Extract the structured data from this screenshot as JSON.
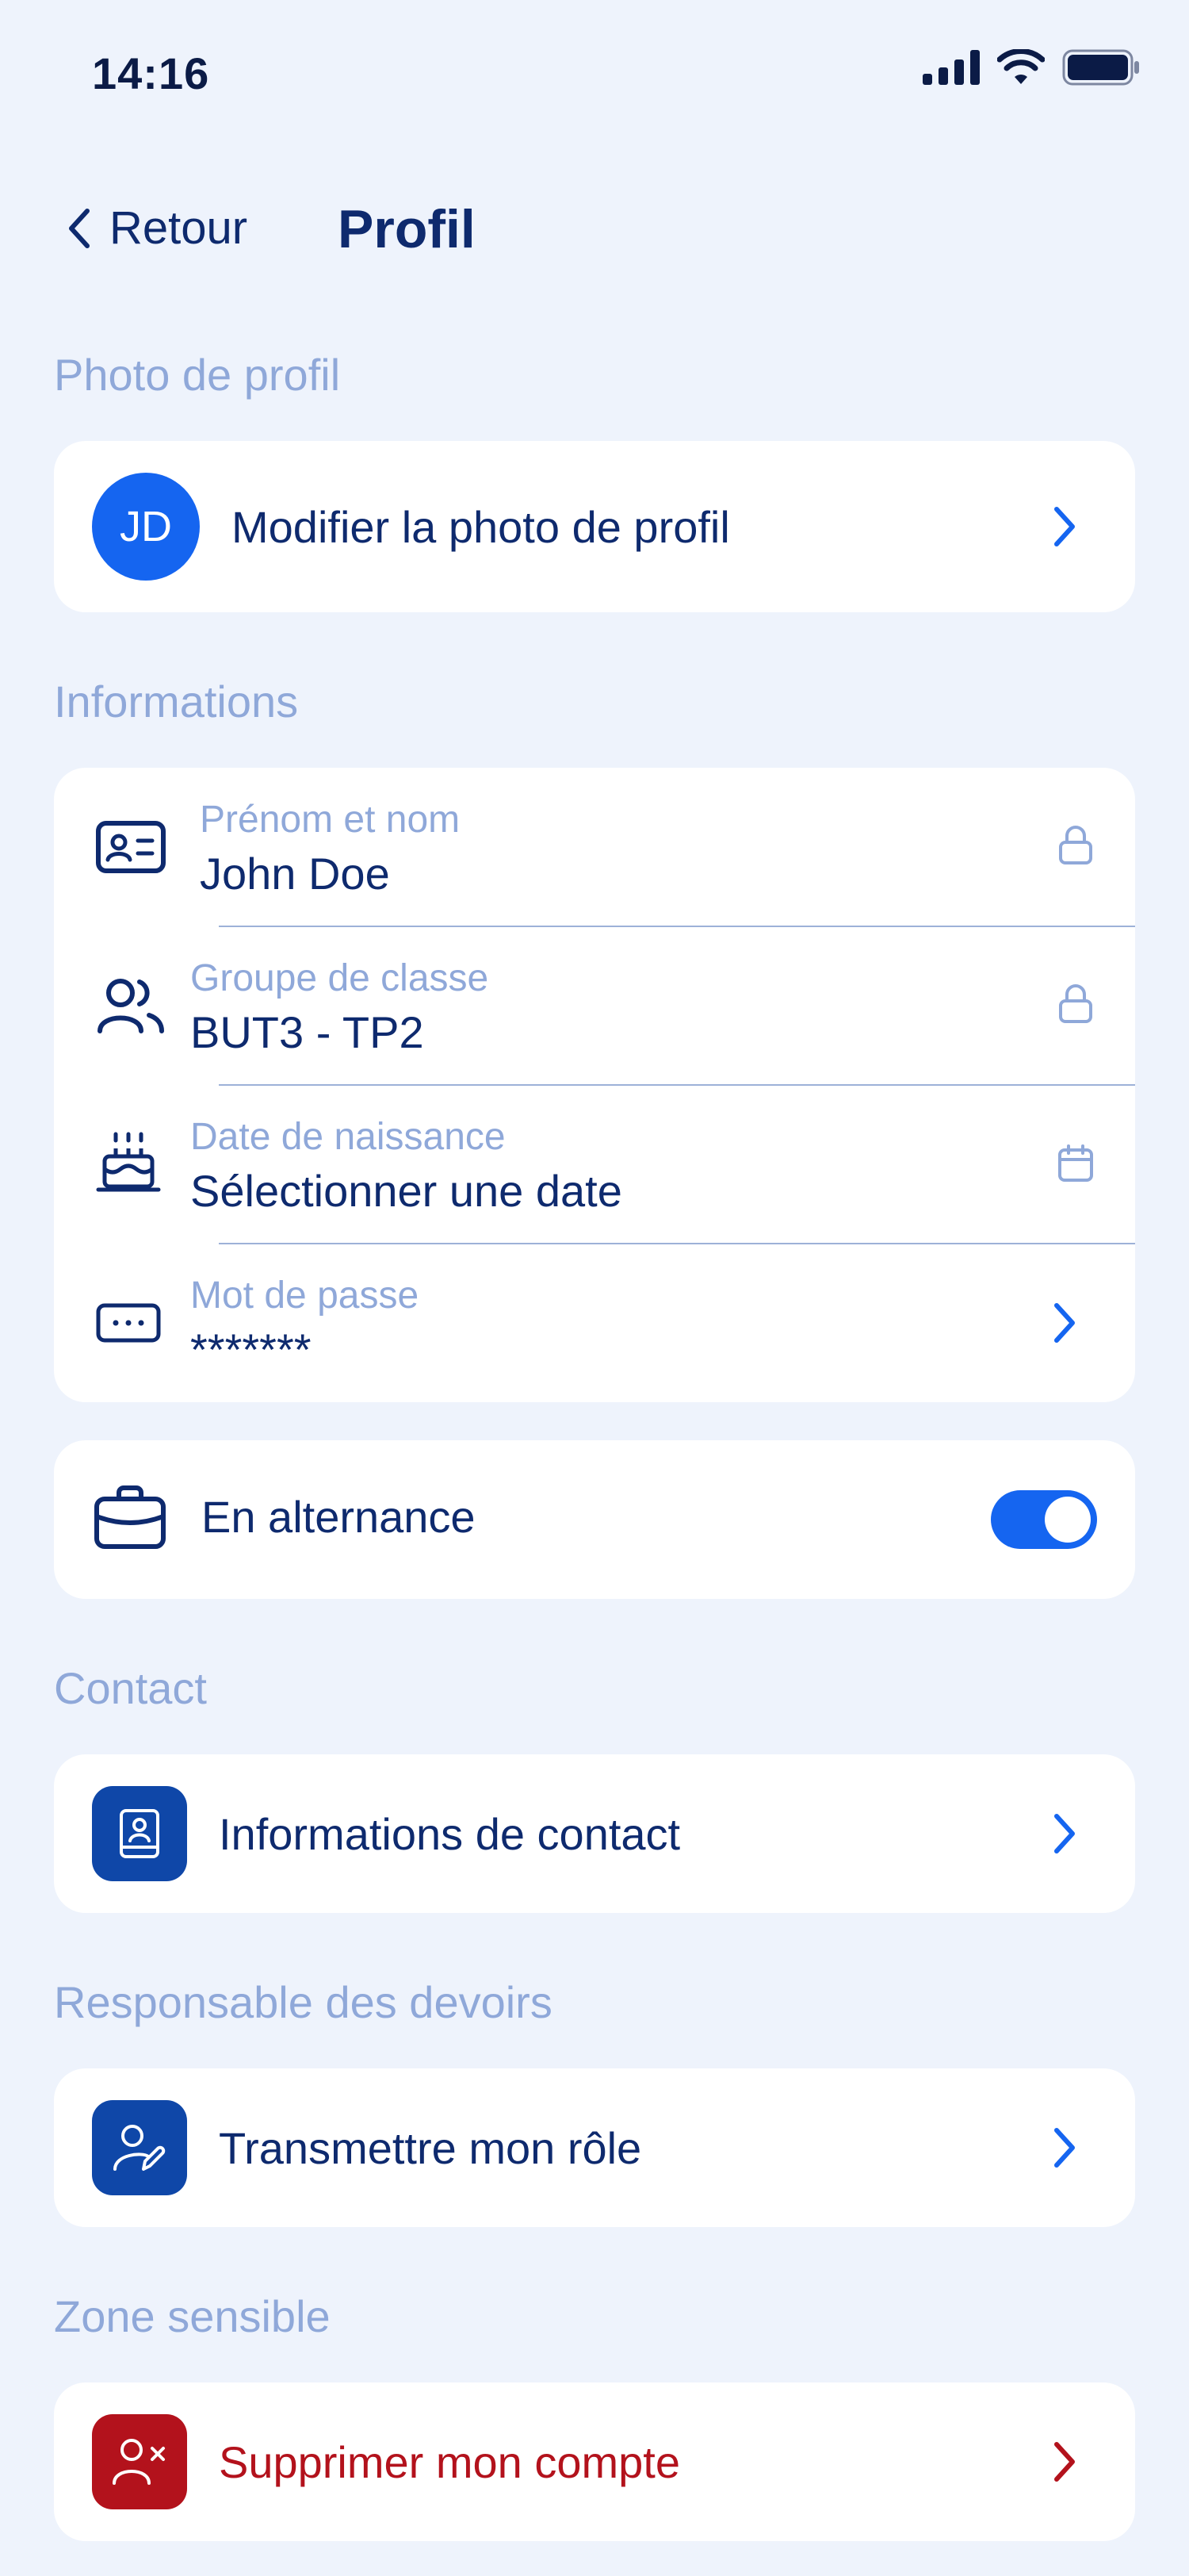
{
  "status_bar": {
    "time": "14:16"
  },
  "nav": {
    "back_label": "Retour",
    "title": "Profil"
  },
  "sections": {
    "photo": {
      "label": "Photo de profil",
      "initials": "JD",
      "action": "Modifier la photo de profil"
    },
    "informations": {
      "label": "Informations",
      "fields": [
        {
          "label": "Prénom et nom",
          "value": "John Doe",
          "icon": "id-card-icon",
          "trailing": "lock-icon"
        },
        {
          "label": "Groupe de classe",
          "value": "BUT3 - TP2",
          "icon": "users-icon",
          "trailing": "lock-icon"
        },
        {
          "label": "Date de naissance",
          "value": "Sélectionner une date",
          "icon": "cake-icon",
          "trailing": "calendar-icon"
        },
        {
          "label": "Mot de passe",
          "value": "*******",
          "icon": "password-icon",
          "trailing": "chevron-right-icon"
        }
      ],
      "alternance": {
        "label": "En alternance",
        "toggle_on": true
      }
    },
    "contact": {
      "label": "Contact",
      "action": "Informations de contact"
    },
    "responsable": {
      "label": "Responsable des devoirs",
      "action": "Transmettre mon rôle"
    },
    "sensible": {
      "label": "Zone sensible",
      "action": "Supprimer mon compte"
    }
  },
  "colors": {
    "background": "#EEF3FC",
    "primary": "#1565F0",
    "navy": "#0E2A6E",
    "muted": "#8FA8D9",
    "tile_blue": "#0F47A8",
    "danger": "#B3121C"
  }
}
